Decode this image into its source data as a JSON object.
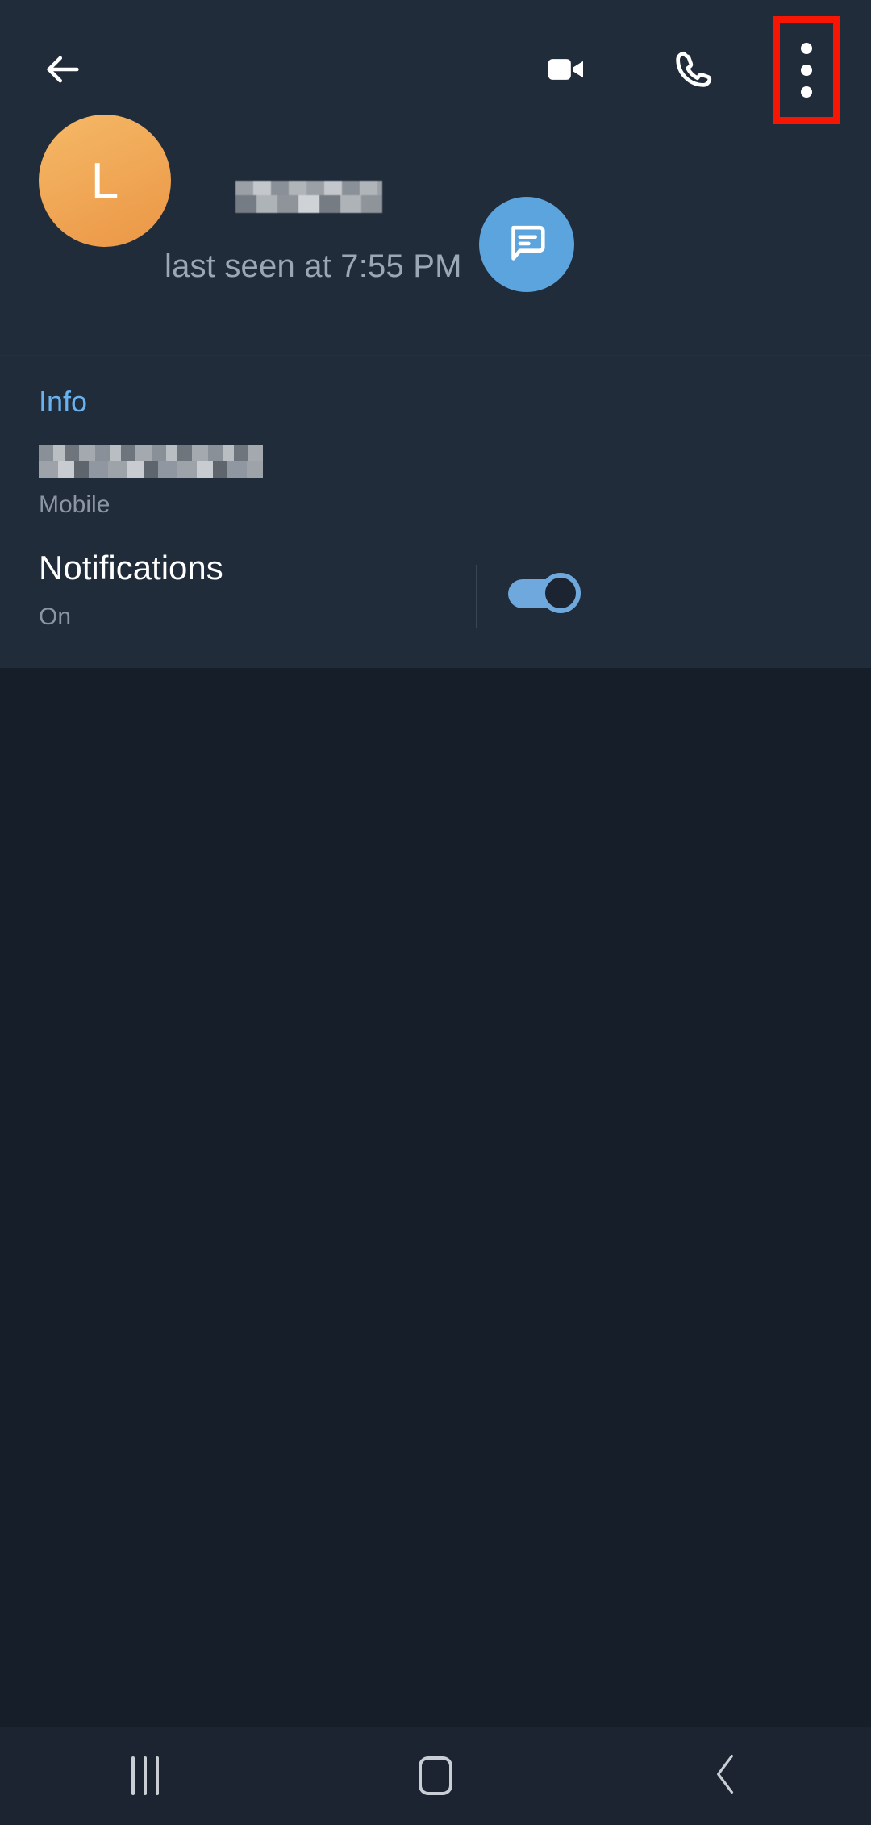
{
  "app": {
    "theme": "dark",
    "background_color": "#1b2430",
    "surface_color": "#212c3a",
    "accent_color": "#6ab2ef",
    "highlight_color": "#f71604"
  },
  "appbar": {
    "back_icon": "arrow-left-icon",
    "video_call_icon": "video-camera-icon",
    "voice_call_icon": "phone-icon",
    "overflow_icon": "more-vertical-icon",
    "overflow_highlighted": true
  },
  "profile": {
    "avatar_letter": "L",
    "avatar_color": "#efa757",
    "contact_name": "",
    "contact_name_redacted": true,
    "status": "last seen at 7:55 PM"
  },
  "fab": {
    "icon": "message-icon",
    "color": "#5ba4dd",
    "label": ""
  },
  "info": {
    "section_title": "Info",
    "phone_number": "",
    "phone_number_redacted": true,
    "phone_label": "Mobile"
  },
  "notifications": {
    "title": "Notifications",
    "value": "On",
    "toggle_on": true,
    "toggle_color": "#6fa8dc"
  },
  "navbar": {
    "recents_icon": "recents-icon",
    "home_icon": "home-icon",
    "back_icon": "back-chevron-icon"
  }
}
